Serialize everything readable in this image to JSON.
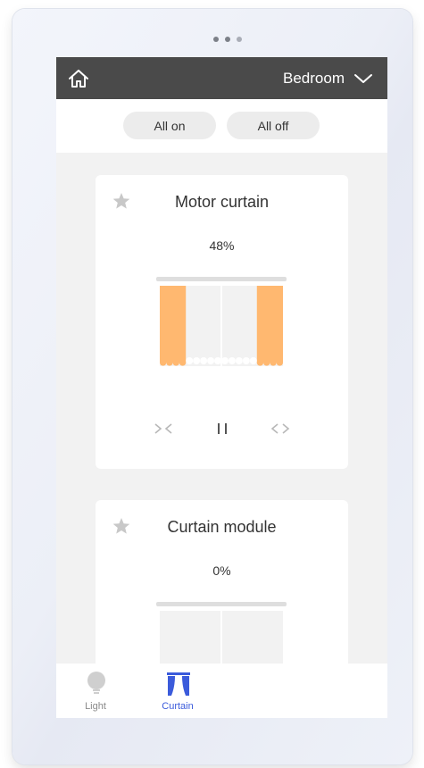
{
  "header": {
    "room_label": "Bedroom"
  },
  "filters": {
    "all_on": "All on",
    "all_off": "All off"
  },
  "cards": [
    {
      "title": "Motor curtain",
      "percent_text": "48%",
      "open_fraction": 0.48,
      "icons": [
        "star-icon",
        "close-curtain-icon",
        "pause-icon",
        "open-curtain-icon"
      ]
    },
    {
      "title": "Curtain module",
      "percent_text": "0%",
      "open_fraction": 0.0,
      "icons": [
        "star-icon"
      ]
    }
  ],
  "tabs": [
    {
      "label": "Light",
      "icon": "lightbulb-icon",
      "active": false
    },
    {
      "label": "Curtain",
      "icon": "curtain-icon",
      "active": true
    }
  ],
  "colors": {
    "topbar": "#4a4a4a",
    "curtain_fabric": "#ffb870",
    "panel_closed": "#f2f2f2",
    "accent": "#3b5bdb",
    "star": "#c8c8c8"
  }
}
